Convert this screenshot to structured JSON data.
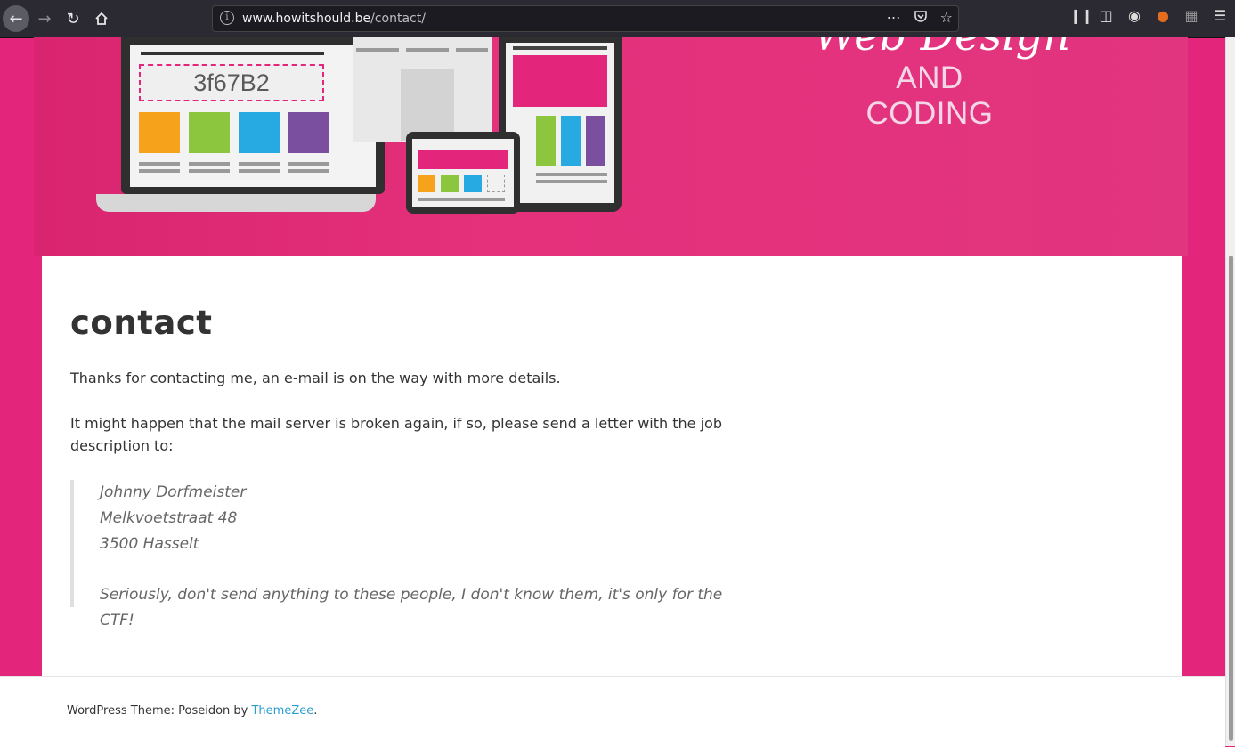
{
  "browser": {
    "url_host": "www.howitshould.be",
    "url_path": "/contact/",
    "back_icon": "arrow-left-icon",
    "forward_icon": "arrow-right-icon",
    "reload_icon": "reload-icon",
    "home_icon": "home-icon"
  },
  "hero": {
    "hex_code": "3f67B2",
    "tagline": "AND CODING",
    "script_fragment": "Web Design",
    "swatch_colors": [
      "#f7a21b",
      "#8cc63f",
      "#27aae1",
      "#7b4fa0"
    ],
    "brand_color": "#e3267b"
  },
  "page": {
    "title": "contact",
    "paragraph1": "Thanks for contacting me, an e-mail is on the way with more details.",
    "paragraph2": "It might happen that the mail server is broken again, if so, please send a letter with the job description to:",
    "address": {
      "name": "Johnny Dorfmeister",
      "street": "Melkvoetstraat 48",
      "city": "3500 Hasselt"
    },
    "note": "Seriously, don't send anything to these people, I don't know them, it's only for the CTF!"
  },
  "footer": {
    "prefix": "WordPress Theme: Poseidon by ",
    "link_label": "ThemeZee",
    "suffix": "."
  }
}
